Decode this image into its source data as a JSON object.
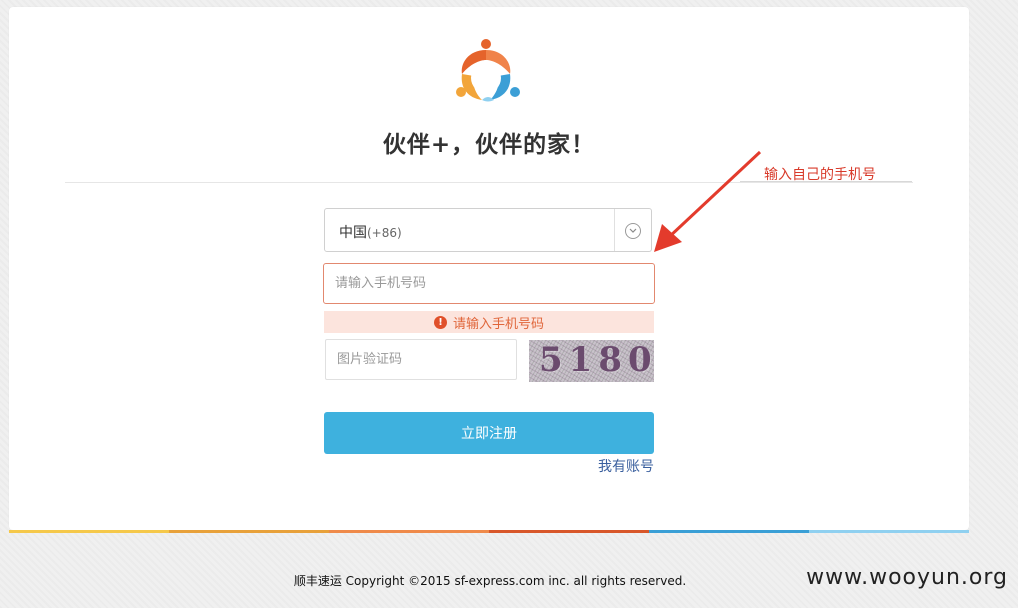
{
  "header": {
    "logo_icon": "partner-people-icon",
    "headline": "伙伴+，伙伴的家！"
  },
  "form": {
    "country_name": "中国",
    "country_code": "(+86)",
    "phone_placeholder": "请输入手机号码",
    "error_message": "请输入手机号码",
    "captcha_placeholder": "图片验证码",
    "captcha_text": "5180",
    "register_label": "立即注册",
    "login_link": "我有账号"
  },
  "annotation": {
    "text": "输入自己的手机号",
    "color": "#d83a2a"
  },
  "footer": {
    "copyright": "顺丰速运 Copyright ©2015 sf-express.com inc. all rights reserved."
  },
  "watermark": "www.wooyun.org",
  "colors": {
    "accent": "#3eb1de",
    "error": "#e0663b",
    "strip": [
      "#f5c84a",
      "#e8a13a",
      "#ef8a4a",
      "#d8572a",
      "#3a9fd6",
      "#8fd0f0"
    ]
  }
}
